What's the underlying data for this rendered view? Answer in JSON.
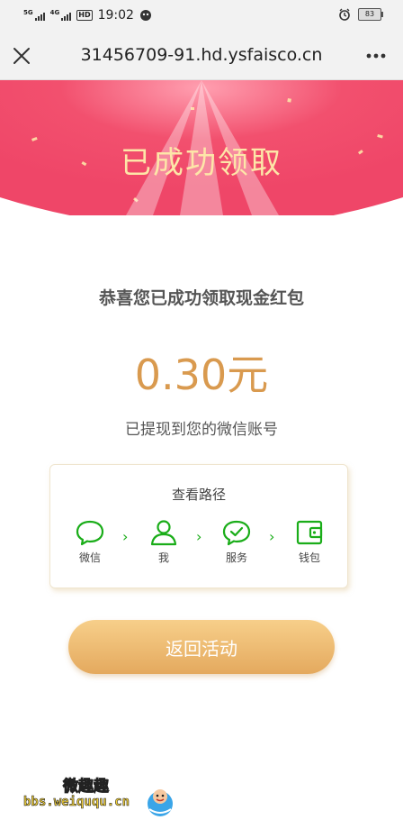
{
  "status_bar": {
    "network1": "5G",
    "network2": "4G",
    "hd_badge": "HD",
    "time": "19:02",
    "battery": "83"
  },
  "browser": {
    "url": "31456709-91.hd.ysfaisco.cn"
  },
  "hero": {
    "title": "已成功领取"
  },
  "result": {
    "congrats": "恭喜您已成功领取现金红包",
    "amount": "0.30元",
    "subtext": "已提现到您的微信账号"
  },
  "path": {
    "title": "查看路径",
    "steps": [
      {
        "label": "微信",
        "icon": "wechat-chat-icon"
      },
      {
        "label": "我",
        "icon": "user-icon"
      },
      {
        "label": "服务",
        "icon": "service-check-icon"
      },
      {
        "label": "钱包",
        "icon": "wallet-icon"
      }
    ]
  },
  "actions": {
    "back_label": "返回活动"
  },
  "watermark": {
    "top": "微趣趣",
    "bottom": "bbs.weiququ.cn"
  },
  "colors": {
    "hero_red": "#f2506e",
    "gold": "#d99a4f",
    "wechat_green": "#1aad19",
    "button_gold": "#eab66c"
  }
}
